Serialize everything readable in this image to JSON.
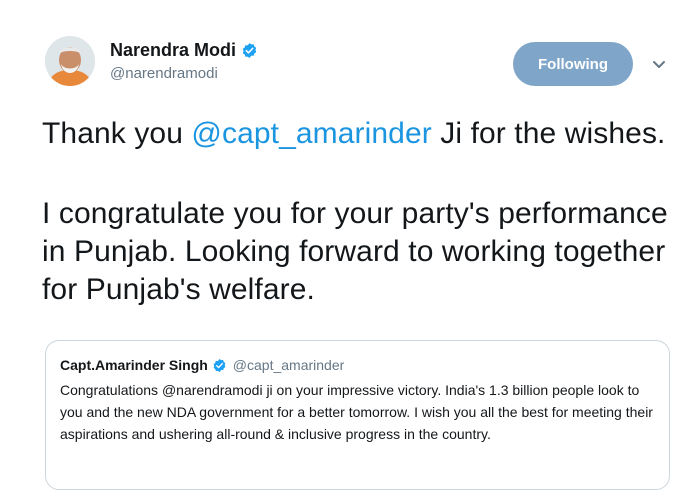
{
  "tweet": {
    "author_name": "Narendra Modi",
    "author_handle": "@narendramodi",
    "follow_label": "Following",
    "text_line1_before": "Thank you ",
    "text_line1_mention": "@capt_amarinder",
    "text_line1_after": " Ji for the wishes.",
    "text_para2": "I congratulate you for your party's performance in Punjab. Looking forward to working together for Punjab's welfare."
  },
  "quote": {
    "author_name": "Capt.Amarinder Singh",
    "author_handle": "@capt_amarinder",
    "text": "Congratulations @narendramodi ji on your impressive victory. India's 1.3 billion people look to you and the new NDA government for a better tomorrow. I wish you all the best for meeting their aspirations and ushering all-round & inclusive progress in the country."
  },
  "colors": {
    "verified": "#1da1f2",
    "follow_button": "#7fa6c9",
    "mention": "#1b95e0"
  },
  "icons": [
    "verified-badge-icon",
    "chevron-down-icon"
  ]
}
